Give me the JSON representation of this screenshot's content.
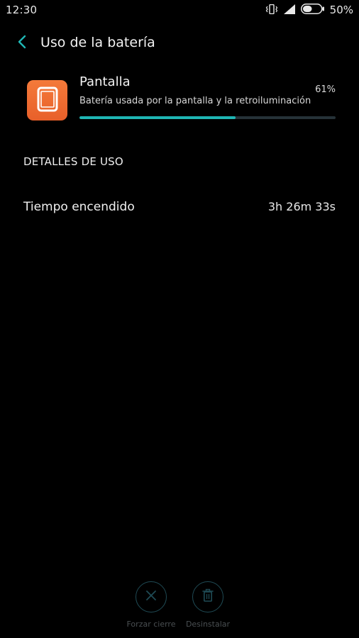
{
  "status_bar": {
    "time": "12:30",
    "battery_percent": "50%",
    "battery_level": 0.5,
    "icons": [
      "vibrate-icon",
      "signal-icon",
      "battery-icon"
    ]
  },
  "header": {
    "title": "Uso de la batería",
    "back_icon": "chevron-left-icon"
  },
  "app": {
    "name": "Pantalla",
    "description": "Batería usada por la pantalla y la retroiluminación",
    "percent": "61%",
    "usage_fraction": 0.61,
    "icon": "tablet-icon"
  },
  "details": {
    "section_title": "DETALLES DE USO",
    "items": [
      {
        "label": "Tiempo encendido",
        "value": "3h 26m 33s"
      }
    ]
  },
  "actions": {
    "force_stop": {
      "label": "Forzar cierre",
      "icon": "close-icon"
    },
    "uninstall": {
      "label": "Desinstalar",
      "icon": "trash-icon"
    }
  },
  "colors": {
    "background": "#000000",
    "accent": "#1fb6b4",
    "app_icon": "#f06a30",
    "disabled": "#1f4b55"
  }
}
